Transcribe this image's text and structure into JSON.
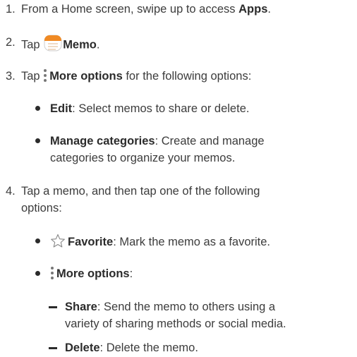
{
  "steps": [
    {
      "number": "1.",
      "pre": "From a Home screen, swipe up to access ",
      "bold": "Apps",
      "post": "."
    },
    {
      "number": "2.",
      "pre": "Tap ",
      "icon": "memo-app-icon",
      "bold": "Memo",
      "post": "."
    },
    {
      "number": "3.",
      "pre": "Tap ",
      "icon": "more-options-icon",
      "bold": "More options",
      "post": " for the following options:"
    },
    {
      "number": "4.",
      "line1": "Tap a memo, and then tap one of the following",
      "line2": "options:"
    }
  ],
  "step3_bullets": [
    {
      "bold": "Edit",
      "text": ": Select memos to share or delete."
    },
    {
      "bold": "Manage categories",
      "text": ": Create and manage",
      "text2": "categories to organize your memos."
    }
  ],
  "step4_bullets": [
    {
      "icon": "star-outline-icon",
      "bold": "Favorite",
      "text": ": Mark the memo as a favorite."
    },
    {
      "icon": "more-options-icon",
      "bold": "More options",
      "text": ":"
    }
  ],
  "more_options_sub": [
    {
      "bold": "Share",
      "text": ": Send the memo to others using a",
      "text2": "variety of sharing methods or social media."
    },
    {
      "bold": "Delete",
      "text": ": Delete the memo."
    }
  ],
  "colors": {
    "text": "#3c3c3c",
    "bold": "#2b2b2b",
    "memo_icon": "#f08a24",
    "icon_gray": "#777777"
  }
}
